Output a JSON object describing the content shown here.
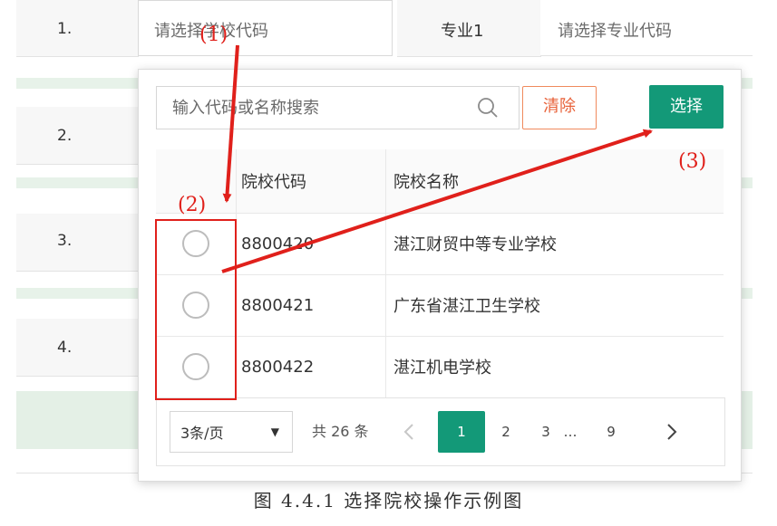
{
  "form": {
    "rows": [
      {
        "num": "1."
      },
      {
        "num": "2."
      },
      {
        "num": "3."
      },
      {
        "num": "4."
      }
    ],
    "school_placeholder": "请选择学校代码",
    "major_label": "专业1",
    "major_placeholder": "请选择专业代码"
  },
  "popup": {
    "search_placeholder": "输入代码或名称搜索",
    "clear_label": "清除",
    "select_label": "选择",
    "columns": [
      "院校代码",
      "院校名称"
    ],
    "schools": [
      {
        "code": "8800420",
        "name": "湛江财贸中等专业学校"
      },
      {
        "code": "8800421",
        "name": "广东省湛江卫生学校"
      },
      {
        "code": "8800422",
        "name": "湛江机电学校"
      }
    ],
    "pager": {
      "page_size": "3条/页",
      "total": "共 26 条",
      "pages": [
        "1",
        "2",
        "3",
        "…",
        "9"
      ],
      "current": "1"
    }
  },
  "annotations": {
    "step1": "(1)",
    "step2": "(2)",
    "step3": "(3)"
  },
  "caption": "图 4.4.1 选择院校操作示例图",
  "colors": {
    "primary": "#139978",
    "danger": "#e8623a",
    "annotation": "#e0201b",
    "stripe": "#e7f2e9"
  }
}
